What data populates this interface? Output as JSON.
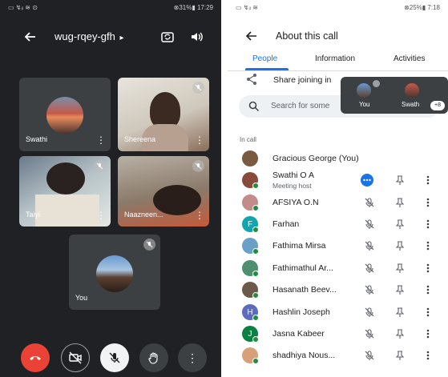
{
  "left_phone": {
    "status_bar": {
      "left": "▭ ↯ᵢₗ ≋ ⊙",
      "right": "⊗31%▮ 17:29"
    },
    "meeting_code": "wug-rqey-gfh",
    "code_chevron": "▸",
    "tiles": [
      {
        "name": "Swathi"
      },
      {
        "name": "Shereena"
      },
      {
        "name": "Taiyi"
      },
      {
        "name": "Naazneen..."
      },
      {
        "name": "You"
      }
    ],
    "more_glyph": "⋮",
    "controls": [
      "end-call",
      "camera-off",
      "mic-off",
      "raise-hand",
      "more-options"
    ]
  },
  "right_phone": {
    "status_bar": {
      "left": "▭ ↯ᵢₗ ≋",
      "right": "⊗25%▮ 7:18"
    },
    "title": "About this call",
    "tabs": [
      "People",
      "Information",
      "Activities"
    ],
    "active_tab": "People",
    "share_label": "Share joining in",
    "search_placeholder": "Search for some",
    "pip": {
      "you_label": "You",
      "other_label": "Swath",
      "badge": "+8"
    },
    "section_label": "In call",
    "participants": [
      {
        "name": "Gracious George (You)",
        "avatar_color": "#7a5a40",
        "initial": "",
        "icons": "none"
      },
      {
        "name": "Swathi O A",
        "subtitle": "Meeting host",
        "avatar_color": "#8a4a3a",
        "initial": "",
        "icons": "host"
      },
      {
        "name": "AFSIYA O.N",
        "avatar_color": "#c48b8b",
        "initial": "",
        "icons": "full"
      },
      {
        "name": "Farhan",
        "avatar_color": "#12a4af",
        "initial": "F",
        "icons": "full"
      },
      {
        "name": "Fathima Mirsa",
        "avatar_color": "#6aa0c8",
        "initial": "",
        "icons": "full"
      },
      {
        "name": "Fathimathul Ar...",
        "avatar_color": "#4f8f70",
        "initial": "",
        "icons": "full"
      },
      {
        "name": "Hasanath Beev...",
        "avatar_color": "#6b5a4a",
        "initial": "",
        "icons": "full"
      },
      {
        "name": "Hashlin Joseph",
        "avatar_color": "#5c6bc0",
        "initial": "H",
        "icons": "full"
      },
      {
        "name": "Jasna Kabeer",
        "avatar_color": "#0b8043",
        "initial": "J",
        "icons": "full"
      },
      {
        "name": "shadhiya Nous...",
        "avatar_color": "#d8a078",
        "initial": "",
        "icons": "full"
      }
    ],
    "accent_color": "#1a73e8"
  }
}
